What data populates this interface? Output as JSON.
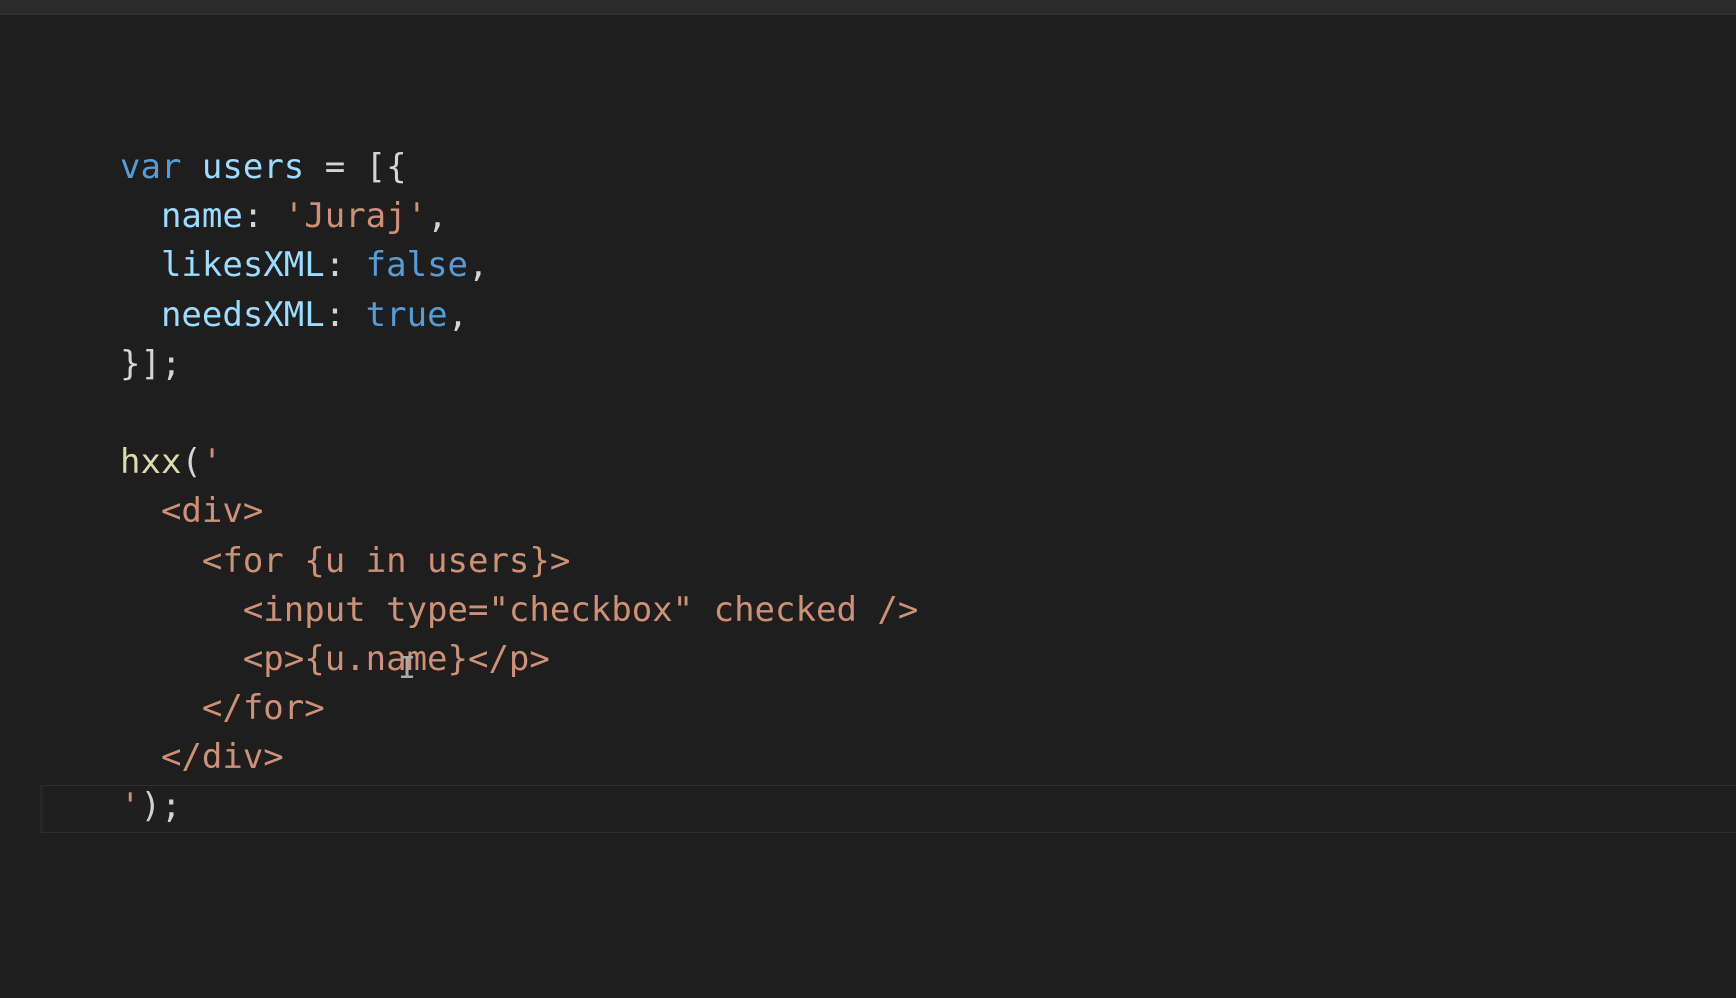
{
  "code_lines": [
    [
      {
        "t": "var",
        "c": "kw"
      },
      {
        "t": " ",
        "c": "punc"
      },
      {
        "t": "users",
        "c": "var"
      },
      {
        "t": " = [{",
        "c": "punc"
      }
    ],
    [
      {
        "t": "  ",
        "c": "punc"
      },
      {
        "t": "name",
        "c": "var"
      },
      {
        "t": ": ",
        "c": "punc"
      },
      {
        "t": "'Juraj'",
        "c": "str"
      },
      {
        "t": ",",
        "c": "punc"
      }
    ],
    [
      {
        "t": "  ",
        "c": "punc"
      },
      {
        "t": "likesXML",
        "c": "var"
      },
      {
        "t": ": ",
        "c": "punc"
      },
      {
        "t": "false",
        "c": "kw"
      },
      {
        "t": ",",
        "c": "punc"
      }
    ],
    [
      {
        "t": "  ",
        "c": "punc"
      },
      {
        "t": "needsXML",
        "c": "var"
      },
      {
        "t": ": ",
        "c": "punc"
      },
      {
        "t": "true",
        "c": "kw"
      },
      {
        "t": ",",
        "c": "punc"
      }
    ],
    [
      {
        "t": "}];",
        "c": "punc"
      }
    ],
    [
      {
        "t": "",
        "c": "punc"
      }
    ],
    [
      {
        "t": "hxx",
        "c": "fn"
      },
      {
        "t": "(",
        "c": "punc"
      },
      {
        "t": "'",
        "c": "str"
      }
    ],
    [
      {
        "t": "  <div>",
        "c": "str"
      }
    ],
    [
      {
        "t": "    <for {u in users}>",
        "c": "str"
      }
    ],
    [
      {
        "t": "      <input type=\"checkbox\" checked />",
        "c": "str"
      }
    ],
    [
      {
        "t": "      <p>{u.name}</p>",
        "c": "str"
      }
    ],
    [
      {
        "t": "    </for>",
        "c": "str"
      }
    ],
    [
      {
        "t": "  </div>",
        "c": "str"
      }
    ],
    [
      {
        "t": "'",
        "c": "str"
      },
      {
        "t": ");",
        "c": "punc"
      }
    ]
  ],
  "colors": {
    "background": "#1e1e1e",
    "keyword": "#569cd6",
    "variable": "#9cdcfe",
    "function": "#dcdcaa",
    "string": "#ce9178",
    "punctuation": "#d4d4d4"
  },
  "cursor_glyph": "I"
}
